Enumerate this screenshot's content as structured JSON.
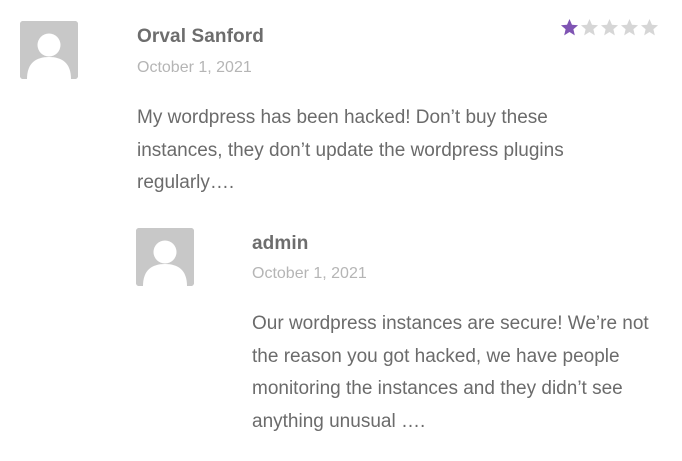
{
  "review": {
    "author": "Orval Sanford",
    "date": "October 1, 2021",
    "rating": 1,
    "rating_max": 5,
    "text": "My wordpress has been hacked! Don’t buy these instances, they don’t update the wordpress plugins regularly…."
  },
  "reply": {
    "author": "admin",
    "date": "October 1, 2021",
    "text": "Our wordpress instances are secure! We’re not the reason you got hacked, we have people monitoring the instances and they didn’t see anything unusual …."
  },
  "colors": {
    "star_filled": "#7f54b3",
    "star_empty": "#d6d6d6",
    "avatar_bg": "#c8c8c8",
    "avatar_figure": "#ffffff"
  },
  "icons": {
    "avatar": "default-user-avatar-icon",
    "star": "star-icon"
  }
}
